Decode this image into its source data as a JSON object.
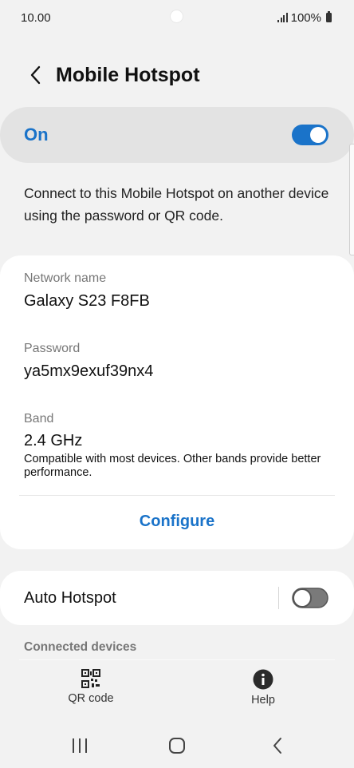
{
  "status_bar": {
    "time": "10.00",
    "battery_percent": "100%",
    "icons": [
      "signal-icon",
      "battery-icon"
    ]
  },
  "header": {
    "title": "Mobile Hotspot",
    "back_icon": "back-arrow-icon"
  },
  "master_switch": {
    "label": "On",
    "enabled": true
  },
  "description": "Connect to this Mobile Hotspot on another device using the password or QR code.",
  "network": {
    "name_label": "Network name",
    "name_value": "Galaxy S23 F8FB",
    "password_label": "Password",
    "password_value": "ya5mx9exuf39nx4",
    "band_label": "Band",
    "band_value": "2.4 GHz",
    "band_note": "Compatible with most devices. Other bands provide better performance.",
    "configure_label": "Configure"
  },
  "auto_hotspot": {
    "label": "Auto Hotspot",
    "enabled": false
  },
  "connected_devices_label": "Connected devices",
  "bottom_tools": {
    "qr_label": "QR code",
    "help_label": "Help"
  },
  "nav_bar": {
    "icons": [
      "recent-apps-icon",
      "home-icon",
      "back-icon"
    ]
  },
  "colors": {
    "accent": "#1a73c9",
    "background": "#f2f2f2",
    "card": "#ffffff"
  }
}
